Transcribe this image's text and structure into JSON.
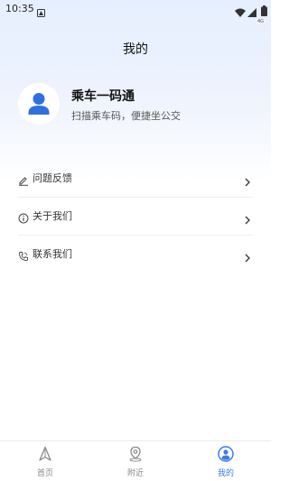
{
  "status_bar": {
    "time": "10:35",
    "net_speed": "4G"
  },
  "header": {
    "title": "我的"
  },
  "profile": {
    "name": "乘车一码通",
    "subtitle": "扫描乘车码，便捷坐公交",
    "avatar_icon": "user-avatar-icon"
  },
  "menu": {
    "items": [
      {
        "label": "问题反馈",
        "icon": "edit-icon"
      },
      {
        "label": "关于我们",
        "icon": "info-icon"
      },
      {
        "label": "联系我们",
        "icon": "phone-icon"
      }
    ]
  },
  "bottom_nav": {
    "tabs": [
      {
        "label": "首页",
        "icon": "navigation-arrow-icon",
        "active": false
      },
      {
        "label": "附近",
        "icon": "location-pin-icon",
        "active": false
      },
      {
        "label": "我的",
        "icon": "user-circle-icon",
        "active": true
      }
    ]
  },
  "colors": {
    "accent": "#3d7be8",
    "inactive": "#8a8a8a",
    "header_gradient_top": "#e6efff"
  }
}
